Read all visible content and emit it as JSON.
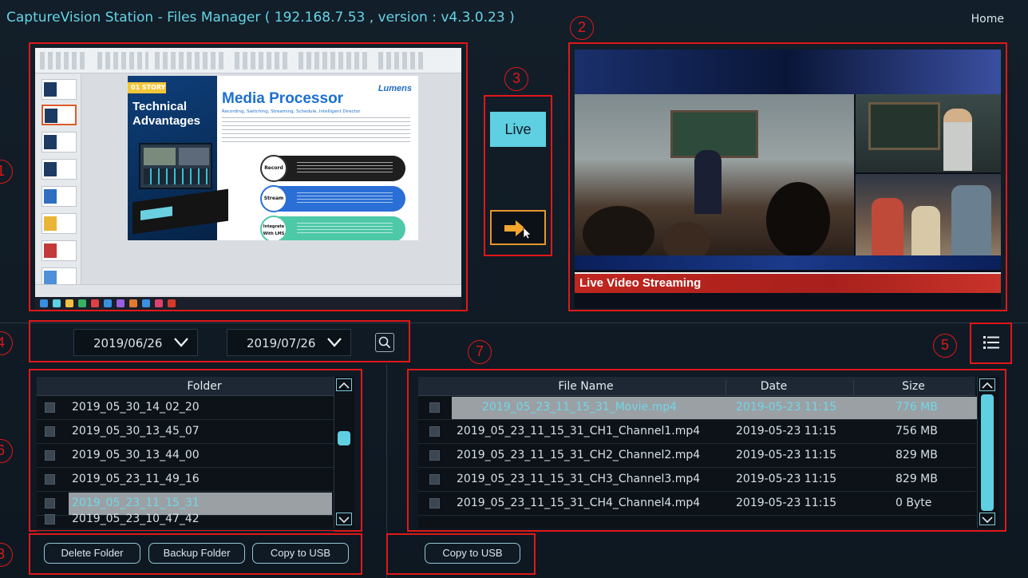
{
  "header": {
    "title": "CaptureVision Station - Files Manager ( 192.168.7.53 , version : v4.3.0.23 )",
    "home_label": "Home"
  },
  "callouts": [
    "1",
    "2",
    "3",
    "4",
    "5",
    "6",
    "7",
    "8"
  ],
  "presentation": {
    "story_tag": "01 STORY",
    "left_title": "Technical Advantages",
    "heading": "Media Processor",
    "logo": "Lumens",
    "subtitle": "Recording, Switching, Streaming, Schedule, Intelligent Director",
    "pills": [
      "Record",
      "Stream",
      "Integrate With LMS"
    ]
  },
  "live_panel": {
    "live_label": "Live",
    "cast_icon": "arrow-pointer-icon"
  },
  "video": {
    "caption": "Live Video Streaming"
  },
  "date_filter": {
    "start_date": "2019/06/26",
    "end_date": "2019/07/26",
    "search_icon": "search-icon"
  },
  "view_toggle_icon": "list-view-icon",
  "folder_table": {
    "header": "Folder",
    "rows": [
      {
        "name": "2019_05_30_14_02_20",
        "selected": false
      },
      {
        "name": "2019_05_30_13_45_07",
        "selected": false
      },
      {
        "name": "2019_05_30_13_44_00",
        "selected": false
      },
      {
        "name": "2019_05_23_11_49_16",
        "selected": false
      },
      {
        "name": "2019_05_23_11_15_31",
        "selected": true
      },
      {
        "name": "2019_05_23_10_47_42",
        "selected": false
      }
    ]
  },
  "file_table": {
    "headers": {
      "name": "File Name",
      "date": "Date",
      "size": "Size"
    },
    "rows": [
      {
        "name": "2019_05_23_11_15_31_Movie.mp4",
        "date": "2019-05-23 11:15",
        "size": "776 MB",
        "selected": true
      },
      {
        "name": "2019_05_23_11_15_31_CH1_Channel1.mp4",
        "date": "2019-05-23 11:15",
        "size": "756 MB",
        "selected": false
      },
      {
        "name": "2019_05_23_11_15_31_CH2_Channel2.mp4",
        "date": "2019-05-23 11:15",
        "size": "829 MB",
        "selected": false
      },
      {
        "name": "2019_05_23_11_15_31_CH3_Channel3.mp4",
        "date": "2019-05-23 11:15",
        "size": "829 MB",
        "selected": false
      },
      {
        "name": "2019_05_23_11_15_31_CH4_Channel4.mp4",
        "date": "2019-05-23 11:15",
        "size": "0 Byte",
        "selected": false
      }
    ]
  },
  "buttons": {
    "delete_folder": "Delete Folder",
    "backup_folder": "Backup Folder",
    "copy_usb_folders": "Copy to USB",
    "copy_usb_files": "Copy to USB"
  },
  "colors": {
    "accent": "#5fcfe2",
    "callout_red": "#e01818",
    "caption_red": "#c0261f",
    "background": "#0f1a24"
  }
}
